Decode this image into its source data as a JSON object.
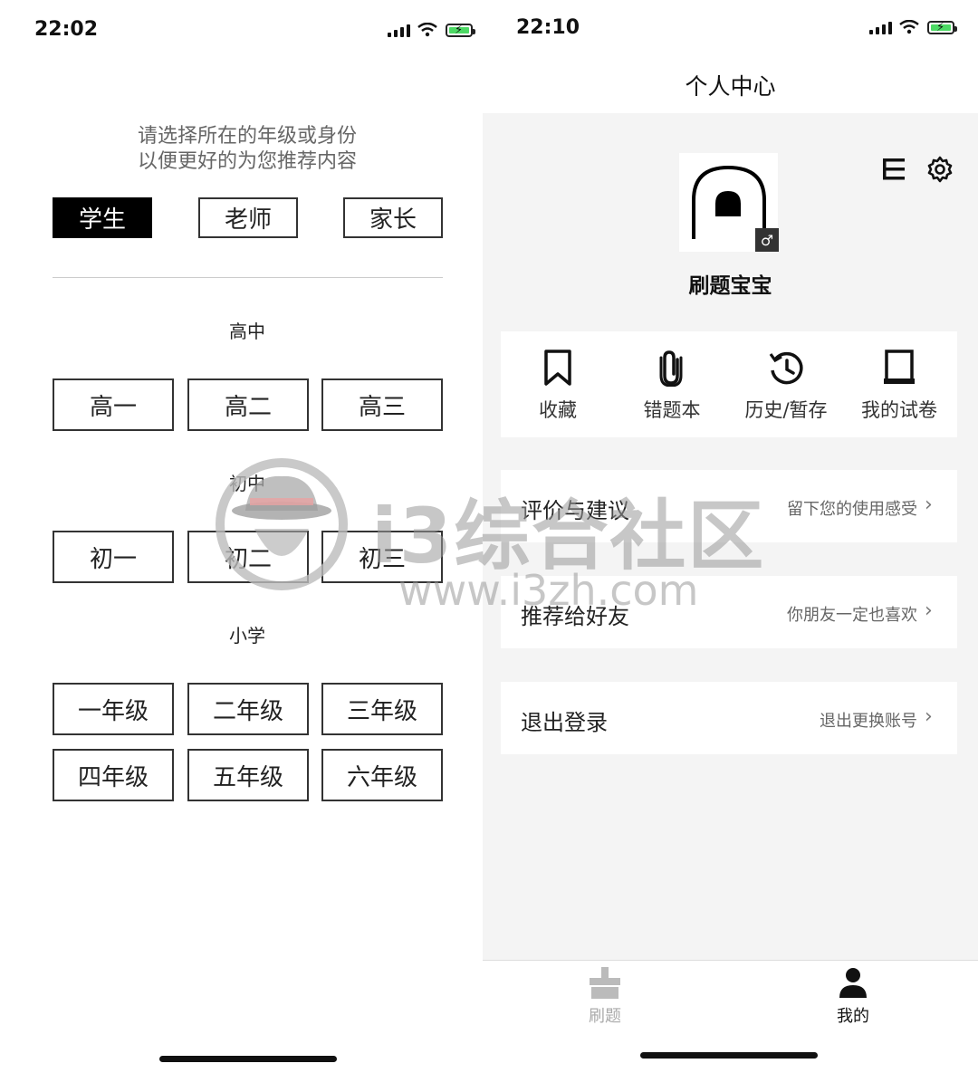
{
  "left": {
    "status": {
      "time": "22:02"
    },
    "prompt_line1": "请选择所在的年级或身份",
    "prompt_line2": "以便更好的为您推荐内容",
    "roles": [
      {
        "label": "学生",
        "selected": true
      },
      {
        "label": "老师",
        "selected": false
      },
      {
        "label": "家长",
        "selected": false
      }
    ],
    "sections": [
      {
        "title": "高中",
        "grades": [
          "高一",
          "高二",
          "高三"
        ]
      },
      {
        "title": "初中",
        "grades": [
          "初一",
          "初二",
          "初三"
        ]
      },
      {
        "title": "小学",
        "grades": [
          "一年级",
          "二年级",
          "三年级",
          "四年级",
          "五年级",
          "六年级"
        ]
      }
    ]
  },
  "right": {
    "status": {
      "time": "22:10"
    },
    "header_title": "个人中心",
    "profile": {
      "nickname": "刷题宝宝",
      "gender_badge": "♂"
    },
    "tools": [
      {
        "label": "收藏",
        "icon": "bookmark-icon"
      },
      {
        "label": "错题本",
        "icon": "paperclip-icon"
      },
      {
        "label": "历史/暂存",
        "icon": "history-icon"
      },
      {
        "label": "我的试卷",
        "icon": "paper-icon"
      }
    ],
    "rows": [
      {
        "title": "评价与建议",
        "subtitle": "留下您的使用感受"
      },
      {
        "title": "推荐给好友",
        "subtitle": "你朋友一定也喜欢"
      },
      {
        "title": "退出登录",
        "subtitle": "退出更换账号"
      }
    ],
    "tabbar": [
      {
        "label": "刷题",
        "active": false,
        "icon": "practice-icon"
      },
      {
        "label": "我的",
        "active": true,
        "icon": "person-icon"
      }
    ]
  },
  "watermark": {
    "brand": "i3综合社区",
    "url": "www.i3zh.com"
  },
  "colors": {
    "panel_bg": "#f4f4f4",
    "selected_bg": "#000000",
    "battery_green": "#4cd964"
  }
}
